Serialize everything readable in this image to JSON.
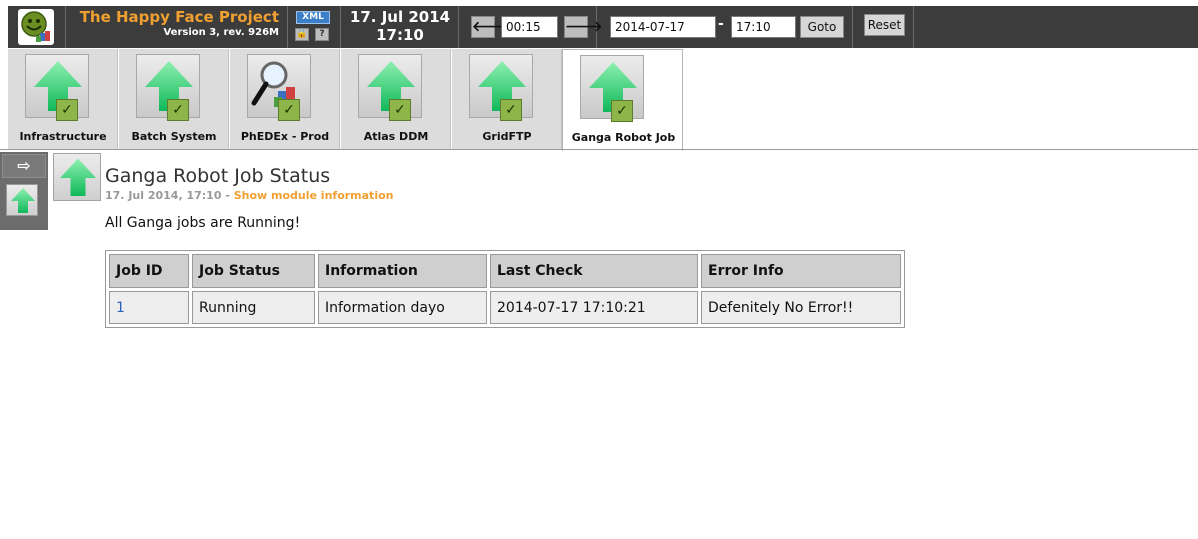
{
  "header": {
    "app_title": "The Happy Face Project",
    "app_version": "Version 3, rev. 926M",
    "xml_label": "XML",
    "lock_glyph": "🔒",
    "help_label": "?",
    "current_date": "17. Jul 2014",
    "current_time": "17:10",
    "step_prev": "🡐",
    "step_value": "00:15",
    "step_next": "🡒",
    "date_value": "2014-07-17",
    "date_separator": "-",
    "time_value": "17:10",
    "goto_label": "Goto",
    "reset_label": "Reset"
  },
  "tabs": [
    {
      "label": "Infrastructure",
      "icon": "green-up-arrow-icon",
      "status": "ok"
    },
    {
      "label": "Batch System",
      "icon": "green-up-arrow-icon",
      "status": "ok"
    },
    {
      "label": "PhEDEx - Prod",
      "icon": "magnifier-icon",
      "status": "ok"
    },
    {
      "label": "Atlas DDM",
      "icon": "green-up-arrow-icon",
      "status": "ok"
    },
    {
      "label": "GridFTP",
      "icon": "green-up-arrow-icon",
      "status": "ok"
    },
    {
      "label": "Ganga Robot Job",
      "icon": "green-up-arrow-icon",
      "status": "ok",
      "active": true
    }
  ],
  "check_glyph": "✓",
  "side": {
    "arrow_glyph": "⇨"
  },
  "module": {
    "title": "Ganga Robot Job Status",
    "timestamp": "17. Jul 2014, 17:10 -",
    "info_link": "Show module information",
    "status_text": "All Ganga jobs are Running!",
    "table": {
      "headers": [
        "Job ID",
        "Job Status",
        "Information",
        "Last Check",
        "Error Info"
      ],
      "rows": [
        [
          "1",
          "Running",
          "Information dayo",
          "2014-07-17 17:10:21",
          "Defenitely No Error!!"
        ]
      ]
    }
  },
  "colors": {
    "header_bg": "#3c3c3c",
    "title_orange": "#f0a030",
    "link_blue": "#2a63b8",
    "ok_green": "#8db54a",
    "arrow_green": "#19c36a"
  }
}
